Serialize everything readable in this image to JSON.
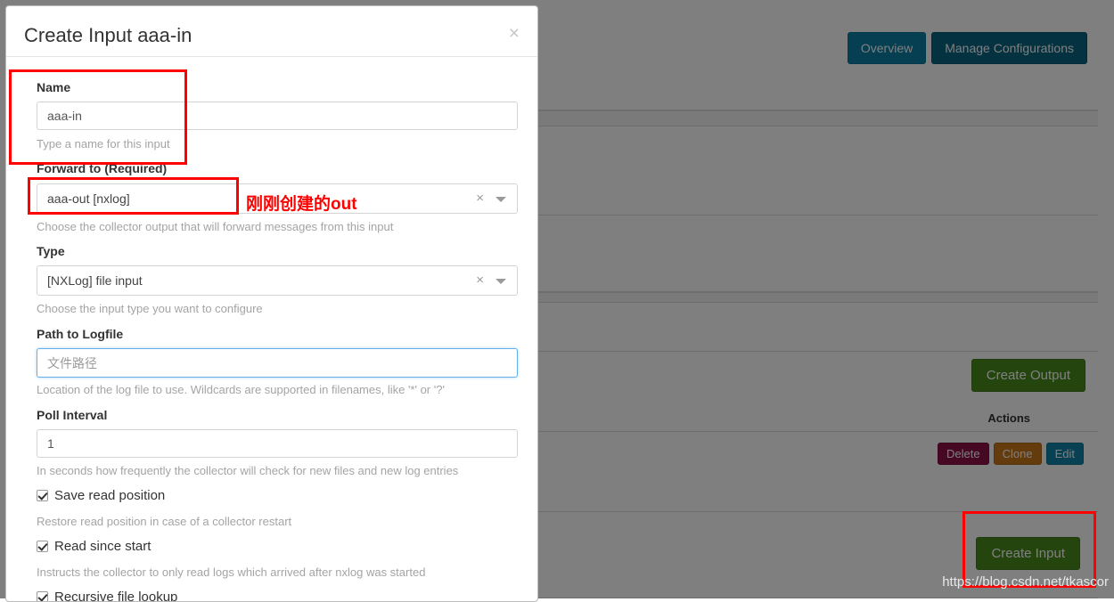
{
  "background": {
    "nav_buttons": [
      {
        "label": "Overview",
        "style": "info"
      },
      {
        "label": "Manage Configurations",
        "style": "info-dark"
      }
    ],
    "create_output_label": "Create Output",
    "create_input_label": "Create Input",
    "actions_column_header": "Actions",
    "row_actions": [
      {
        "label": "Delete",
        "style": "danger"
      },
      {
        "label": "Clone",
        "style": "warning"
      },
      {
        "label": "Edit",
        "style": "primary"
      }
    ],
    "watermark": "https://blog.csdn.net/tkascor"
  },
  "modal": {
    "title": "Create Input aaa-in",
    "close_label": "×",
    "fields": {
      "name": {
        "label": "Name",
        "value": "aaa-in",
        "placeholder": "",
        "help": "Type a name for this input"
      },
      "forward_to": {
        "label": "Forward to (Required)",
        "value": "aaa-out [nxlog]",
        "clear_label": "×",
        "help": "Choose the collector output that will forward messages from this input"
      },
      "type": {
        "label": "Type",
        "value": "[NXLog] file input",
        "clear_label": "×",
        "help": "Choose the input type you want to configure"
      },
      "path_to_logfile": {
        "label": "Path to Logfile",
        "value": "",
        "placeholder": "文件路径",
        "help": "Location of the log file to use. Wildcards are supported in filenames, like '*' or '?'"
      },
      "poll_interval": {
        "label": "Poll Interval",
        "value": "1",
        "placeholder": "",
        "help": "In seconds how frequently the collector will check for new files and new log entries"
      }
    },
    "checkboxes": [
      {
        "label": "Save read position",
        "checked": true,
        "help": "Restore read position in case of a collector restart"
      },
      {
        "label": "Read since start",
        "checked": true,
        "help": "Instructs the collector to only read logs which arrived after nxlog was started"
      },
      {
        "label": "Recursive file lookup",
        "checked": true,
        "help": ""
      }
    ]
  },
  "annotations": {
    "note_text": "刚刚创建的out",
    "color": "#ff0000"
  },
  "colors": {
    "accent_info": "#0b7ea3",
    "accent_info_dark": "#0a6482",
    "accent_success": "#4a8a1e",
    "accent_danger": "#8f1049",
    "accent_warning": "#c8761a",
    "accent_primary": "#1283a8",
    "annotation_red": "#ff0000",
    "focus_blue": "#66afe9"
  }
}
